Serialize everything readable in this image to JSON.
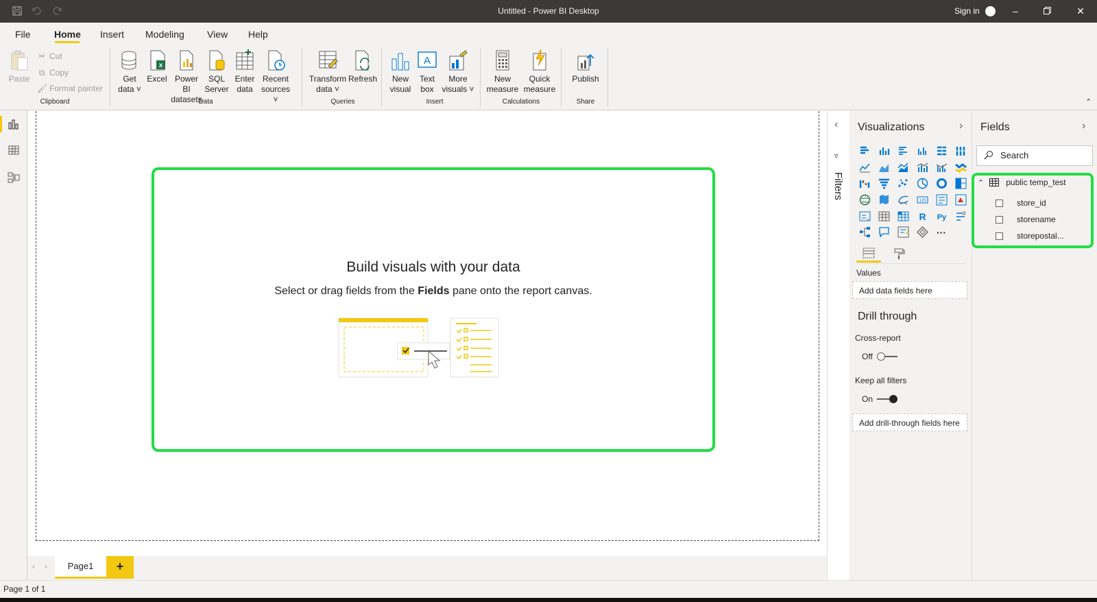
{
  "window": {
    "title": "Untitled - Power BI Desktop",
    "sign_in": "Sign in"
  },
  "icons": {
    "save": "save-icon",
    "undo": "undo-icon",
    "redo": "redo-icon",
    "minimize": "minimize-icon",
    "restore": "restore-icon",
    "close": "close-icon"
  },
  "menu": {
    "tabs": [
      "File",
      "Home",
      "Insert",
      "Modeling",
      "View",
      "Help"
    ],
    "active": "Home"
  },
  "ribbon": {
    "clipboard": {
      "paste": "Paste",
      "cut": "Cut",
      "copy": "Copy",
      "format_painter": "Format painter",
      "group": "Clipboard"
    },
    "data": {
      "get_data": [
        "Get",
        "data"
      ],
      "excel": "Excel",
      "power_bi_datasets": [
        "Power BI",
        "datasets"
      ],
      "sql_server": [
        "SQL",
        "Server"
      ],
      "enter_data": [
        "Enter",
        "data"
      ],
      "recent_sources": [
        "Recent",
        "sources"
      ],
      "group": "Data"
    },
    "queries": {
      "transform_data": [
        "Transform",
        "data"
      ],
      "refresh": "Refresh",
      "group": "Queries"
    },
    "insert": {
      "new_visual": [
        "New",
        "visual"
      ],
      "text_box": [
        "Text",
        "box"
      ],
      "more_visuals": [
        "More",
        "visuals"
      ],
      "group": "Insert"
    },
    "calculations": {
      "new_measure": [
        "New",
        "measure"
      ],
      "quick_measure": [
        "Quick",
        "measure"
      ],
      "group": "Calculations"
    },
    "share": {
      "publish": "Publish",
      "group": "Share"
    }
  },
  "canvas": {
    "heading": "Build visuals with your data",
    "sub_before": "Select or drag fields from the ",
    "sub_bold": "Fields",
    "sub_after": " pane onto the report canvas."
  },
  "pages": {
    "tabs": [
      "Page1"
    ],
    "add": "+"
  },
  "status": {
    "text": "Page 1 of 1"
  },
  "filters": {
    "label": "Filters"
  },
  "visualizations": {
    "title": "Visualizations",
    "more": "···",
    "values_label": "Values",
    "add_data_fields": "Add data fields here",
    "drill_through": "Drill through",
    "cross_report": "Cross-report",
    "cross_report_state": "Off",
    "keep_all_filters": "Keep all filters",
    "keep_all_filters_state": "On",
    "add_drill_fields": "Add drill-through fields here"
  },
  "fields": {
    "title": "Fields",
    "search_placeholder": "Search",
    "table_name": "public temp_test",
    "columns": [
      "store_id",
      "storename",
      "storepostal..."
    ]
  },
  "colors": {
    "accent": "#f2c811",
    "highlight": "#22dd44",
    "titlebar": "#3b3a39"
  }
}
